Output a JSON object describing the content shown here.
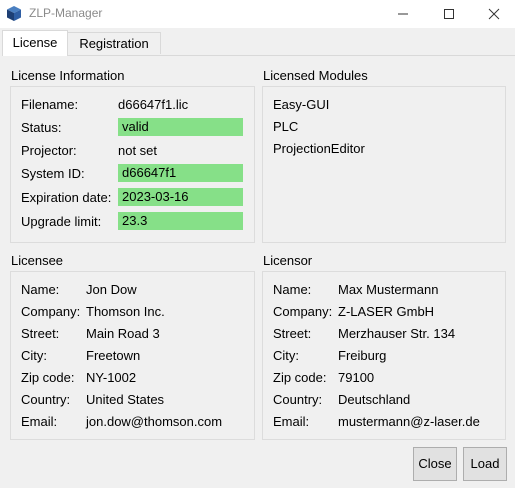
{
  "window": {
    "title": "ZLP-Manager"
  },
  "tabs": [
    {
      "label": "License"
    },
    {
      "label": "Registration"
    }
  ],
  "license_info": {
    "title": "License Information",
    "rows": [
      {
        "label": "Filename:",
        "value": "d66647f1.lic"
      },
      {
        "label": "Status:",
        "value": "valid"
      },
      {
        "label": "Projector:",
        "value": "not set"
      },
      {
        "label": "System ID:",
        "value": "d66647f1"
      },
      {
        "label": "Expiration date:",
        "value": "2023-03-16"
      },
      {
        "label": "Upgrade limit:",
        "value": "23.3"
      }
    ]
  },
  "licensed_modules": {
    "title": "Licensed Modules",
    "items": [
      "Easy-GUI",
      "PLC",
      "ProjectionEditor"
    ]
  },
  "licensee": {
    "title": "Licensee",
    "rows": [
      {
        "label": "Name:",
        "value": "Jon Dow"
      },
      {
        "label": "Company:",
        "value": "Thomson Inc."
      },
      {
        "label": "Street:",
        "value": "Main Road 3"
      },
      {
        "label": "City:",
        "value": "Freetown"
      },
      {
        "label": "Zip code:",
        "value": "NY-1002"
      },
      {
        "label": "Country:",
        "value": "United States"
      },
      {
        "label": "Email:",
        "value": "jon.dow@thomson.com"
      }
    ]
  },
  "licensor": {
    "title": "Licensor",
    "rows": [
      {
        "label": "Name:",
        "value": "Max Mustermann"
      },
      {
        "label": "Company:",
        "value": "Z-LASER GmbH"
      },
      {
        "label": "Street:",
        "value": "Merzhauser Str. 134"
      },
      {
        "label": "City:",
        "value": "Freiburg"
      },
      {
        "label": "Zip code:",
        "value": "79100"
      },
      {
        "label": "Country:",
        "value": "Deutschland"
      },
      {
        "label": "Email:",
        "value": "mustermann@z-laser.de"
      }
    ]
  },
  "buttons": {
    "close": "Close",
    "load": "Load"
  },
  "colors": {
    "valid_highlight": "#86e088",
    "background": "#f0f0f0"
  }
}
